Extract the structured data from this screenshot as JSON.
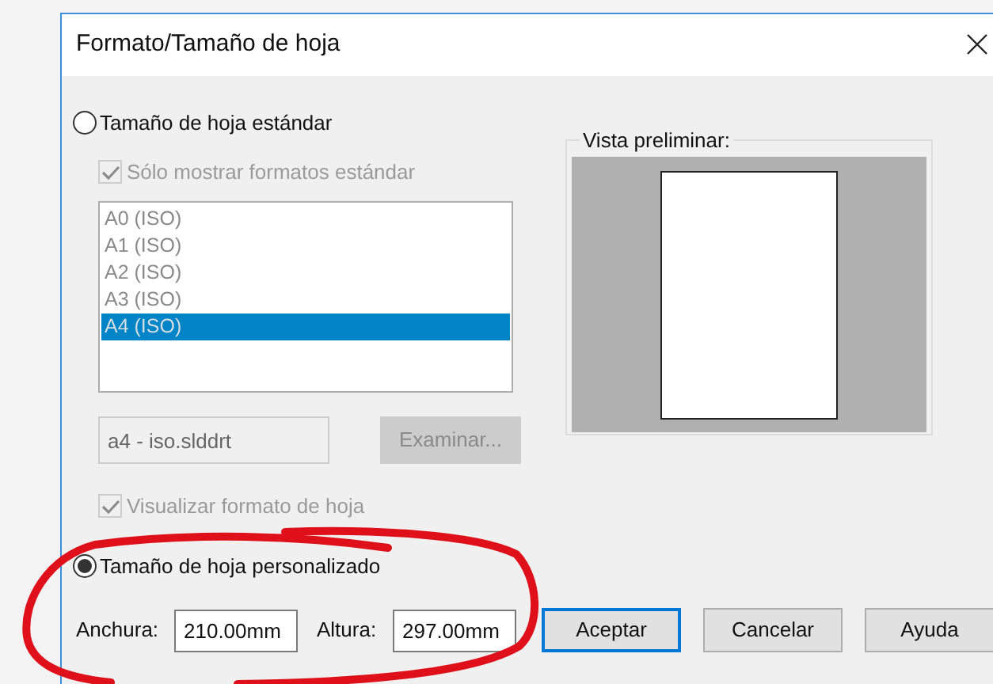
{
  "window": {
    "title": "Formato/Tamaño de hoja"
  },
  "standard": {
    "label": "Tamaño de hoja estándar",
    "selected": false,
    "only_standard": {
      "label": "Sólo mostrar formatos estándar",
      "checked": true,
      "disabled": true
    },
    "formats": [
      {
        "label": "A0 (ISO)",
        "selected": false
      },
      {
        "label": "A1 (ISO)",
        "selected": false
      },
      {
        "label": "A2 (ISO)",
        "selected": false
      },
      {
        "label": "A3 (ISO)",
        "selected": false
      },
      {
        "label": "A4 (ISO)",
        "selected": true
      }
    ],
    "template": {
      "value": "a4 - iso.slddrt",
      "disabled": true
    },
    "browse": {
      "label": "Examinar...",
      "disabled": true
    },
    "show_format": {
      "label": "Visualizar formato de hoja",
      "checked": true,
      "disabled": true
    }
  },
  "preview": {
    "title": "Vista preliminar:"
  },
  "custom": {
    "label": "Tamaño de hoja personalizado",
    "selected": true,
    "width": {
      "label": "Anchura:",
      "value": "210.00mm"
    },
    "height": {
      "label": "Altura:",
      "value": "297.00mm"
    }
  },
  "buttons": [
    {
      "label": "Aceptar",
      "default": true
    },
    {
      "label": "Cancelar",
      "default": false
    },
    {
      "label": "Ayuda",
      "default": false
    }
  ]
}
